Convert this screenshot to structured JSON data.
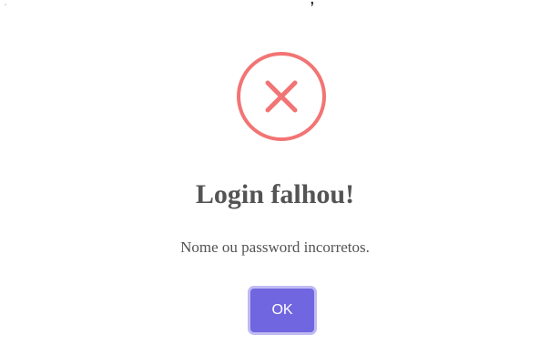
{
  "top_partial_text": ", ",
  "dialog": {
    "icon": "x-mark-icon",
    "icon_color": "#f27474",
    "title": "Login falhou!",
    "message": "Nome ou password incorretos.",
    "confirm_label": "OK",
    "confirm_color": "#7066e0"
  }
}
